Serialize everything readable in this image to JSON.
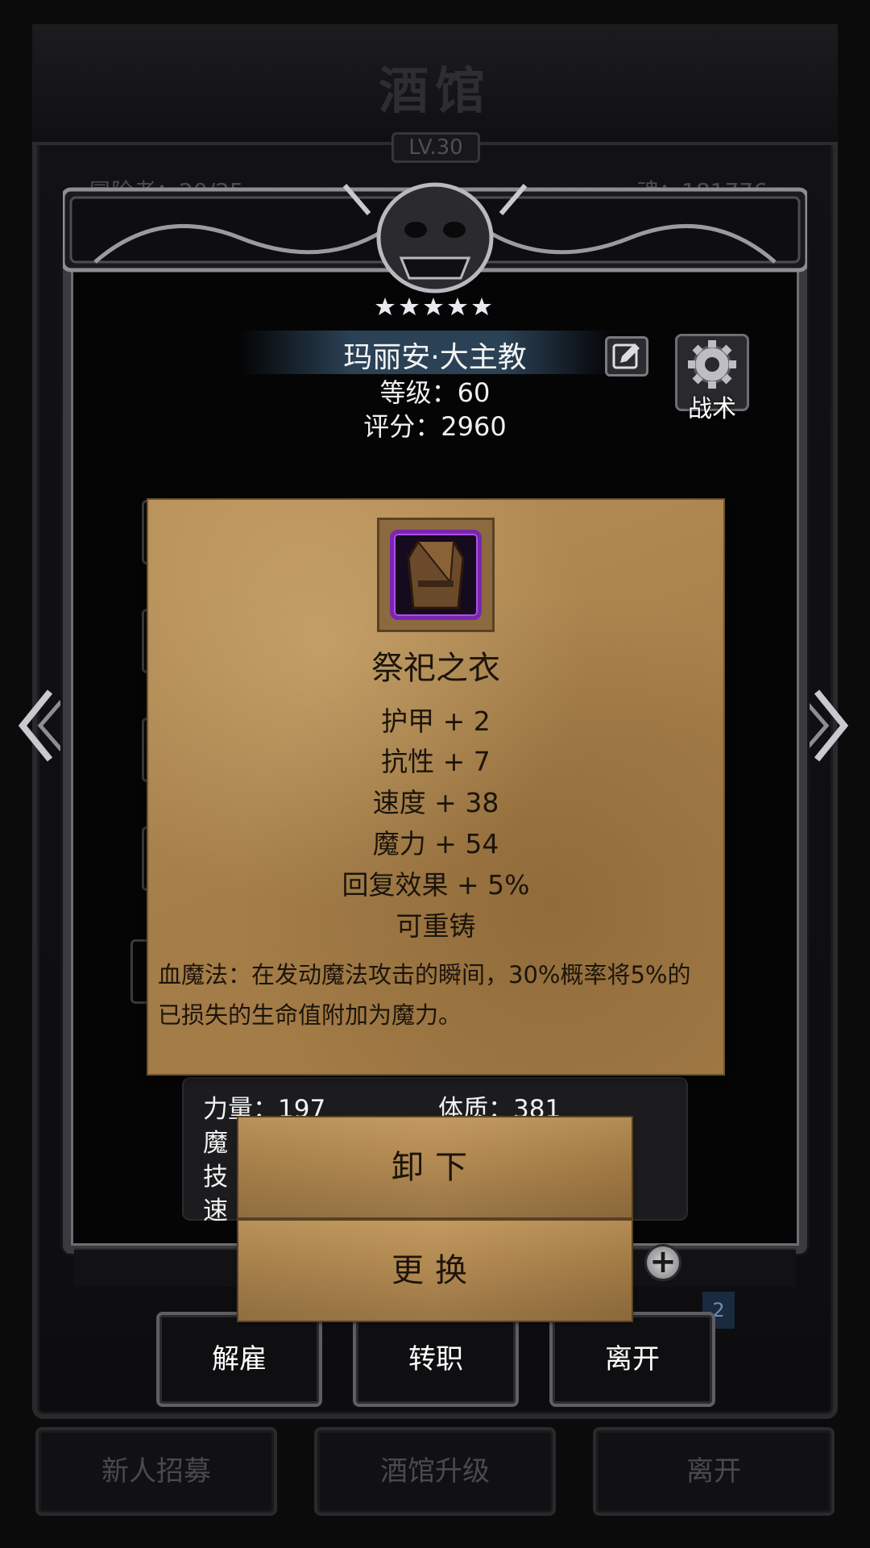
{
  "background": {
    "title": "酒馆",
    "level": "LV.30",
    "adventurers": "冒险者：20/25",
    "souls": "魂：181776"
  },
  "bottom_bar": {
    "recruit": "新人招募",
    "upgrade": "酒馆升级",
    "leave": "离开"
  },
  "character": {
    "name": "玛丽安·大主教",
    "level": "等级：60",
    "score": "评分：2960",
    "tactics_label": "战术"
  },
  "stats": {
    "strength": "力量：197",
    "constitution": "体质：381",
    "magic_partial": "魔",
    "skill_partial": "技",
    "speed_partial": "速"
  },
  "page_indicator": "2",
  "item": {
    "name": "祭祀之衣",
    "stats": [
      "护甲 + 2",
      "抗性 + 7",
      "速度 + 38",
      "魔力 + 54",
      "回复效果 + 5%",
      "可重铸"
    ],
    "description": "血魔法：在发动魔法攻击的瞬间，30%概率将5%的已损失的生命值附加为魔力。",
    "rarity_color": "#7a27b0"
  },
  "item_actions": {
    "unequip": "卸下",
    "replace": "更换"
  },
  "dialog_actions": {
    "dismiss": "解雇",
    "change_class": "转职",
    "leave": "离开"
  },
  "colors": {
    "parchment": "#a47d48",
    "frame": "#3a3a3f",
    "name_banner": "#2b4256"
  }
}
